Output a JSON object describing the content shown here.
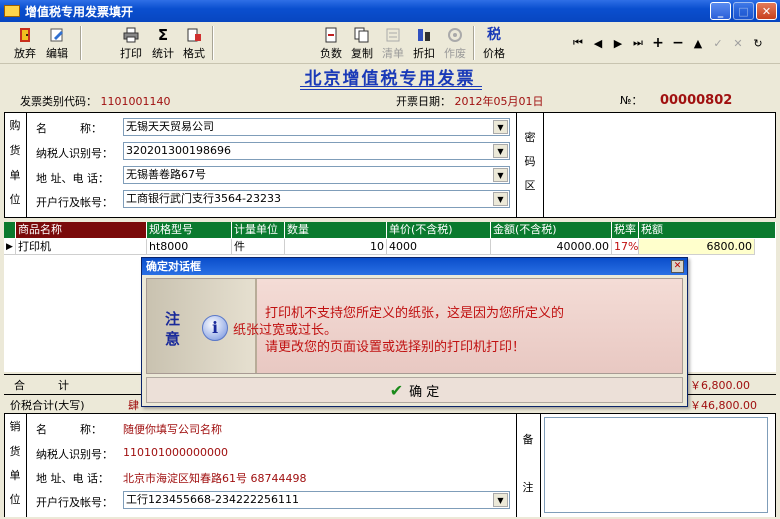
{
  "window": {
    "title": "增值税专用发票填开"
  },
  "toolbar": {
    "discard": "放弃",
    "edit": "编辑",
    "print": "打印",
    "stats": "统计",
    "format": "格式",
    "negative": "负数",
    "copy": "复制",
    "clear_list": "清单",
    "discount": "折扣",
    "void": "作废",
    "tax_label": "税",
    "price": "价格"
  },
  "invoice": {
    "title": "北京增值税专用发票",
    "code_label": "发票类别代码：",
    "code": "1101001140",
    "date_label": "开票日期：",
    "date": "2012年05月01日",
    "number_label": "№：",
    "number": "00000802"
  },
  "buyer": {
    "side": [
      "购",
      "货",
      "单",
      "位"
    ],
    "name_label": "名　　　称：",
    "name": "无锡天天贸易公司",
    "taxid_label": "纳税人识别号：",
    "taxid": "320201300198696",
    "addr_label": "地 址、电 话：",
    "addr": "无锡善卷路67号",
    "bank_label": "开户行及帐号：",
    "bank": "工商银行武门支行3564-23233",
    "code_area": [
      "密",
      "码",
      "区"
    ]
  },
  "grid": {
    "headers": [
      "商品名称",
      "规格型号",
      "计量单位",
      "数量",
      "单价(不含税)",
      "金额(不含税)",
      "税率",
      "税额"
    ],
    "row": [
      "打印机",
      "ht8000",
      "件",
      "10",
      "4000",
      "40000.00",
      "17%",
      "6800.00"
    ]
  },
  "totals": {
    "sum_label": "合　　　计",
    "sum_tax": "￥6,800.00",
    "total_label": "价税合计(大写)",
    "total_upper_start": "肆",
    "total": "￥46,800.00"
  },
  "seller": {
    "side": [
      "销",
      "货",
      "单",
      "位"
    ],
    "name_label": "名　　　称：",
    "name": "随便你填写公司名称",
    "taxid_label": "纳税人识别号：",
    "taxid": "110101000000000",
    "addr_label": "地 址、电 话：",
    "addr": "北京市海淀区知春路61号 68744498",
    "bank_label": "开户行及帐号：",
    "bank": "工行123455668-234222256111",
    "remark": [
      "备",
      "注"
    ]
  },
  "dialog": {
    "title": "确定对话框",
    "notice": "注意",
    "line1": "打印机不支持您所定义的纸张，这是因为您所定义的",
    "line2": "纸张过宽或过长。",
    "line3": "请更改您的页面设置或选择别的打印机打印！",
    "ok": "确 定"
  }
}
